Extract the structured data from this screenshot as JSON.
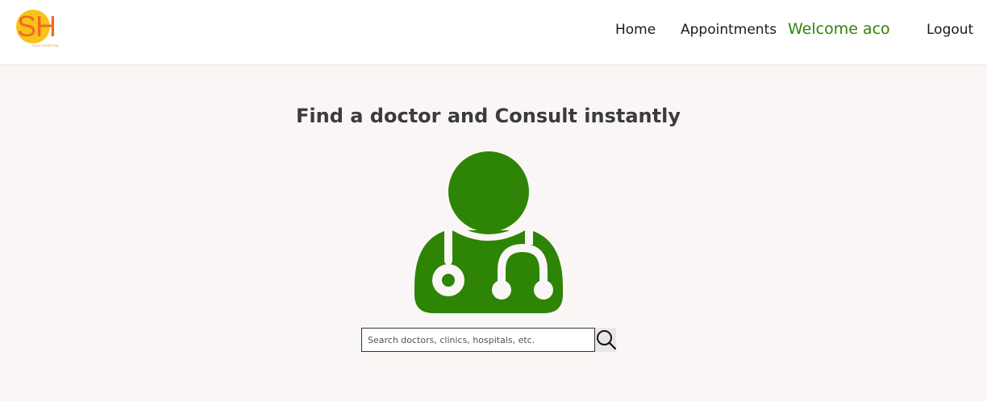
{
  "header": {
    "logo": {
      "text": "SH",
      "subtext": "SUVI HOSPITAL"
    },
    "nav": {
      "home": "Home",
      "appointments": "Appointments",
      "welcome": "Welcome aco",
      "logout": "Logout"
    }
  },
  "main": {
    "title": "Find a doctor and Consult instantly",
    "illustration_icon": "doctor-stethoscope-icon",
    "search": {
      "placeholder": "Search doctors, clinics, hospitals, etc.",
      "value": "",
      "button_icon": "search-icon"
    }
  },
  "colors": {
    "brand_green": "#2e8405",
    "logo_orange": "#f26a1f",
    "logo_yellow": "#f7c31a",
    "background": "#faf6f5"
  }
}
